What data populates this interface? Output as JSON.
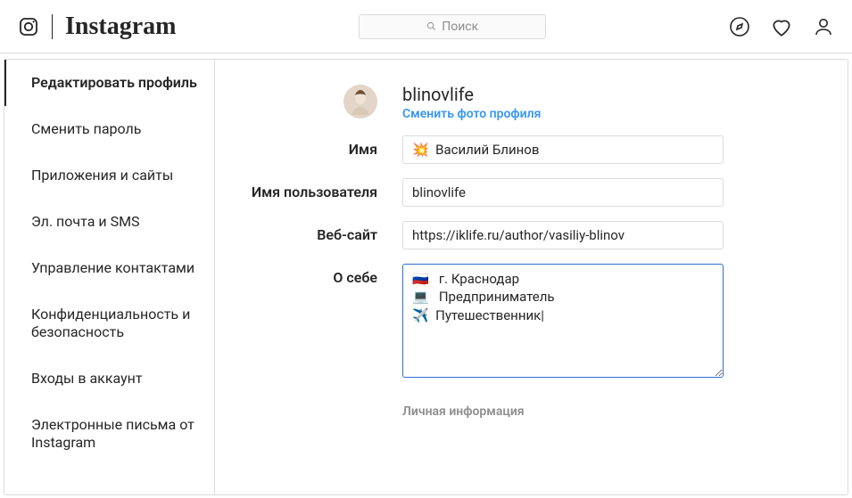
{
  "brand": {
    "wordmark": "Instagram"
  },
  "search": {
    "placeholder": "Поиск"
  },
  "sidebar": {
    "items": [
      {
        "label": "Редактировать профиль"
      },
      {
        "label": "Сменить пароль"
      },
      {
        "label": "Приложения и сайты"
      },
      {
        "label": "Эл. почта и SMS"
      },
      {
        "label": "Управление контактами"
      },
      {
        "label": "Конфиденциальность и безопасность"
      },
      {
        "label": "Входы в аккаунт"
      },
      {
        "label": "Электронные письма от Instagram"
      }
    ]
  },
  "profile": {
    "username": "blinovlife",
    "change_photo": "Сменить фото профиля",
    "labels": {
      "name": "Имя",
      "username": "Имя пользователя",
      "website": "Веб-сайт",
      "bio": "О себе"
    },
    "fields": {
      "name": "💥  Василий Блинов",
      "username": "blinovlife",
      "website": "https://iklife.ru/author/vasiliy-blinov",
      "bio": "🇷🇺   г. Краснодар\n💻   Предприниматель\n✈️  Путешественник|"
    },
    "section_personal": "Личная информация"
  }
}
